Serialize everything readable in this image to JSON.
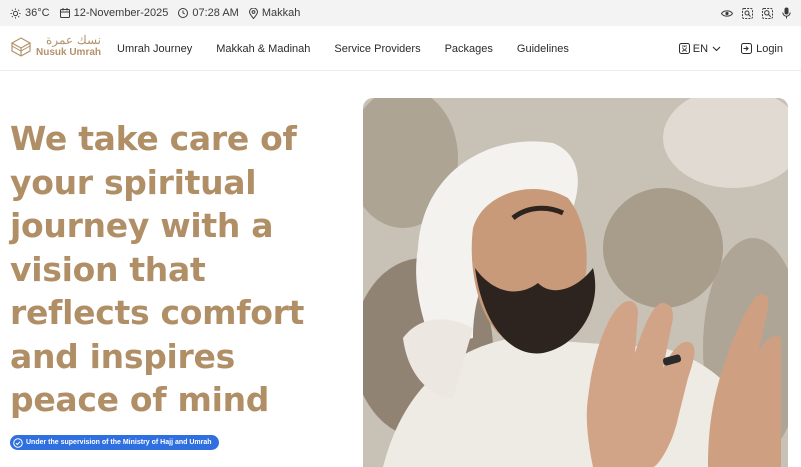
{
  "topbar": {
    "temperature": "36°C",
    "date": "12-November-2025",
    "time": "07:28 AM",
    "location": "Makkah",
    "icons": [
      "sun-icon",
      "calendar-icon",
      "clock-icon",
      "location-pin-icon",
      "eye-icon",
      "screen-search-icon",
      "search-icon",
      "microphone-icon"
    ]
  },
  "header": {
    "logo_arabic": "نسك عمرة",
    "logo_english": "Nusuk Umrah",
    "nav": [
      {
        "label": "Umrah Journey"
      },
      {
        "label": "Makkah & Madinah"
      },
      {
        "label": "Service Providers"
      },
      {
        "label": "Packages"
      },
      {
        "label": "Guidelines"
      }
    ],
    "language": "EN",
    "login": "Login"
  },
  "hero": {
    "title": "We take care of your spiritual journey with a vision that reflects comfort and inspires peace of mind",
    "badge": "Under the supervision of the Ministry of Hajj and Umrah"
  },
  "colors": {
    "accent_gold": "#b08e66",
    "badge_blue": "#2f6fe0",
    "topbar_bg": "#f3f3f3"
  }
}
